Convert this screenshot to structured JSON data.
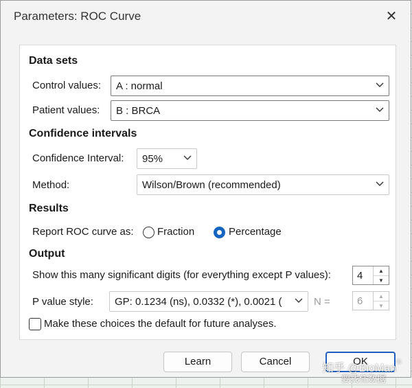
{
  "window": {
    "title": "Parameters: ROC Curve"
  },
  "data_sets": {
    "heading": "Data sets",
    "control_label": "Control values:",
    "control_value": "A : normal",
    "patient_label": "Patient values:",
    "patient_value": "B : BRCA"
  },
  "confidence": {
    "heading": "Confidence intervals",
    "ci_label": "Confidence Interval:",
    "ci_value": "95%",
    "method_label": "Method:",
    "method_value": "Wilson/Brown (recommended)"
  },
  "results": {
    "heading": "Results",
    "report_label": "Report ROC curve as:",
    "option_fraction": "Fraction",
    "option_percentage": "Percentage",
    "selected": "Percentage"
  },
  "output": {
    "heading": "Output",
    "digits_label": "Show this many significant digits (for everything except P values):",
    "digits_value": "4",
    "pstyle_label": "P value style:",
    "pstyle_value": "GP: 0.1234 (ns), 0.0332 (*), 0.0021 (",
    "n_label": "N =",
    "n_value": "6",
    "default_label": "Make these choices the default for future analyses."
  },
  "buttons": {
    "learn": "Learn",
    "cancel": "Cancel",
    "ok": "OK"
  },
  "watermark": {
    "line1": "知乎 @BioMan",
    "mark": "®",
    "line2": "要找任数据"
  },
  "colors": {
    "accent": "#1565c0",
    "ok_border": "#1f5fbf"
  }
}
